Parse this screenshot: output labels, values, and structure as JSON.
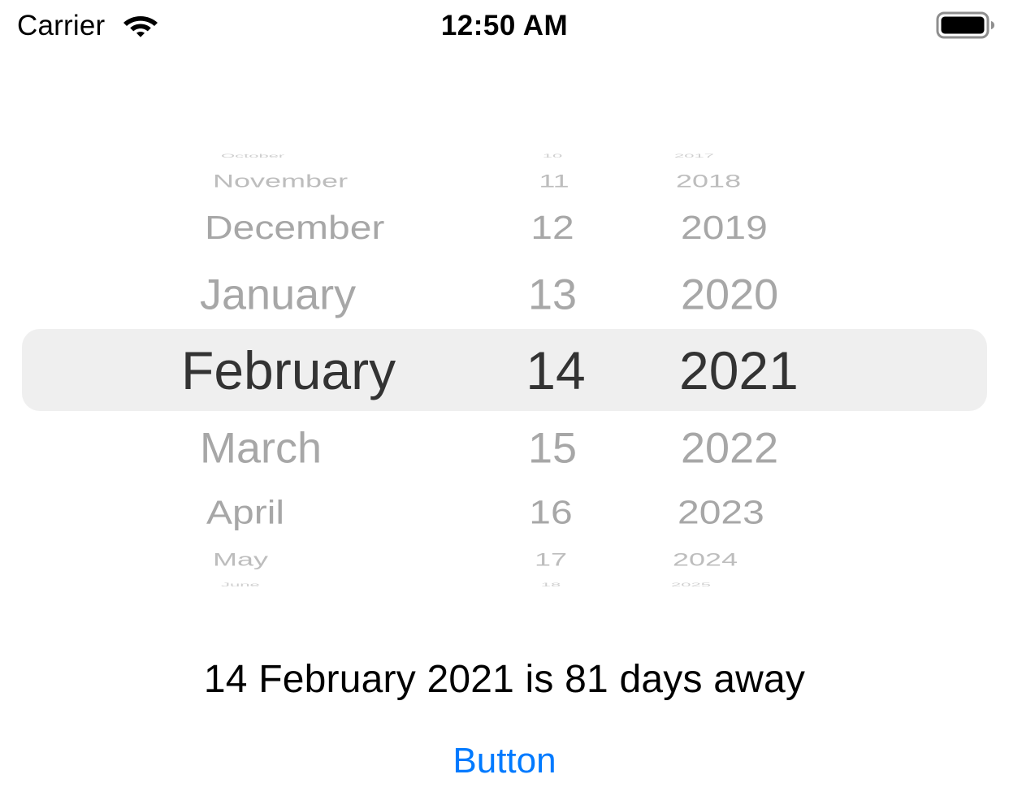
{
  "status_bar": {
    "carrier": "Carrier",
    "time": "12:50 AM",
    "wifi_icon": "wifi-icon",
    "battery_icon": "battery-full-icon"
  },
  "picker": {
    "months": [
      "October",
      "November",
      "December",
      "January",
      "February",
      "March",
      "April",
      "May",
      "June"
    ],
    "days": [
      "10",
      "11",
      "12",
      "13",
      "14",
      "15",
      "16",
      "17",
      "18"
    ],
    "years": [
      "2017",
      "2018",
      "2019",
      "2020",
      "2021",
      "2022",
      "2023",
      "2024",
      "2025"
    ],
    "selected": {
      "month": "February",
      "day": "14",
      "year": "2021"
    }
  },
  "result_text": "14 February 2021 is 81 days away",
  "button_label": "Button",
  "colors": {
    "accent": "#007aff",
    "selected_text": "#333333",
    "dim_text": "#a7a7a7",
    "selection_band": "#efefef"
  }
}
